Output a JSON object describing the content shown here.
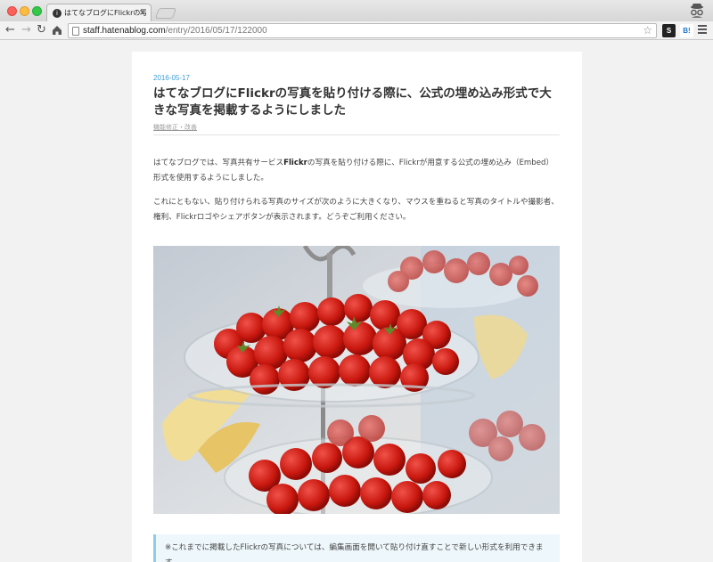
{
  "browser": {
    "tab_title": "はてなブログにFlickrの写真を貼り付",
    "url_host": "staff.hatenablog.com",
    "url_path": "/entry/2016/05/17/122000",
    "ext_s_label": "S",
    "ext_b_label": "B!"
  },
  "article": {
    "date": "2016-05-17",
    "title": "はてなブログにFlickrの写真を貼り付ける際に、公式の埋め込み形式で大きな写真を掲載するようにしました",
    "category": "機能修正・改善",
    "p1_before": "はてなブログでは、写真共有サービス",
    "p1_bold": "Flickr",
    "p1_after": "の写真を貼り付ける際に、Flickrが用意する公式の埋め込み（Embed）形式を使用するようにしました。",
    "p2": "これにともない、貼り付けられる写真のサイズが次のように大きくなり、マウスを重ねると写真のタイトルや撮影者、権利、Flickrロゴやシェアボタンが表示されます。どうぞご利用ください。",
    "note": "※これまでに掲載したFlickrの写真については、編集画面を開いて貼り付け直すことで新しい形式を利用できます。"
  },
  "icons": {
    "back": "back-arrow-icon",
    "forward": "forward-arrow-icon",
    "reload": "reload-icon",
    "home": "home-icon",
    "star": "bookmark-star-icon",
    "menu": "hamburger-menu-icon"
  },
  "colors": {
    "accent": "#3a9fd8",
    "note_border": "#8ccde8",
    "note_bg": "#eef7fb"
  }
}
